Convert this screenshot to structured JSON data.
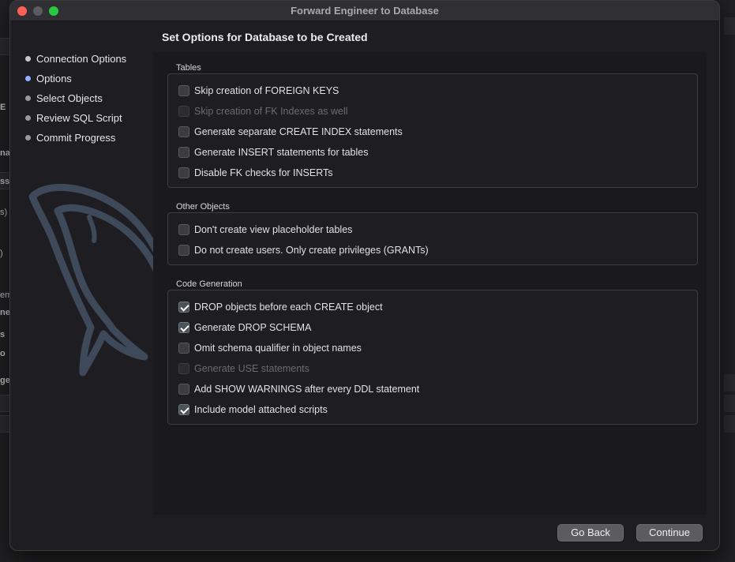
{
  "window": {
    "title": "Forward Engineer to Database"
  },
  "steps": [
    {
      "label": "Connection Options",
      "state": "done"
    },
    {
      "label": "Options",
      "state": "active"
    },
    {
      "label": "Select Objects",
      "state": "pending"
    },
    {
      "label": "Review SQL Script",
      "state": "pending"
    },
    {
      "label": "Commit Progress",
      "state": "pending"
    }
  ],
  "page": {
    "heading": "Set Options for Database to be Created"
  },
  "groups": {
    "tables": {
      "label": "Tables",
      "options": [
        {
          "label": "Skip creation of FOREIGN KEYS",
          "checked": false,
          "enabled": true
        },
        {
          "label": "Skip creation of FK Indexes as well",
          "checked": false,
          "enabled": false
        },
        {
          "label": "Generate separate CREATE INDEX statements",
          "checked": false,
          "enabled": true
        },
        {
          "label": "Generate INSERT statements for tables",
          "checked": false,
          "enabled": true
        },
        {
          "label": "Disable FK checks for INSERTs",
          "checked": false,
          "enabled": true
        }
      ]
    },
    "other": {
      "label": "Other Objects",
      "options": [
        {
          "label": "Don't create view placeholder tables",
          "checked": false,
          "enabled": true
        },
        {
          "label": "Do not create users. Only create privileges (GRANTs)",
          "checked": false,
          "enabled": true
        }
      ]
    },
    "code": {
      "label": "Code Generation",
      "options": [
        {
          "label": "DROP objects before each CREATE object",
          "checked": true,
          "enabled": true
        },
        {
          "label": "Generate DROP SCHEMA",
          "checked": true,
          "enabled": true
        },
        {
          "label": "Omit schema qualifier in object names",
          "checked": false,
          "enabled": true
        },
        {
          "label": "Generate USE statements",
          "checked": false,
          "enabled": false
        },
        {
          "label": "Add SHOW WARNINGS after every DDL statement",
          "checked": false,
          "enabled": true
        },
        {
          "label": "Include model attached scripts",
          "checked": true,
          "enabled": true
        }
      ]
    }
  },
  "buttons": {
    "back": "Go Back",
    "continue": "Continue"
  },
  "background_fragments": [
    "E",
    "na",
    "ss",
    "s)",
    ")",
    "em",
    "ne",
    "s",
    "o",
    "ge"
  ],
  "colors": {
    "accent_dot": "#8fb1ff",
    "check": "#ffffff"
  }
}
